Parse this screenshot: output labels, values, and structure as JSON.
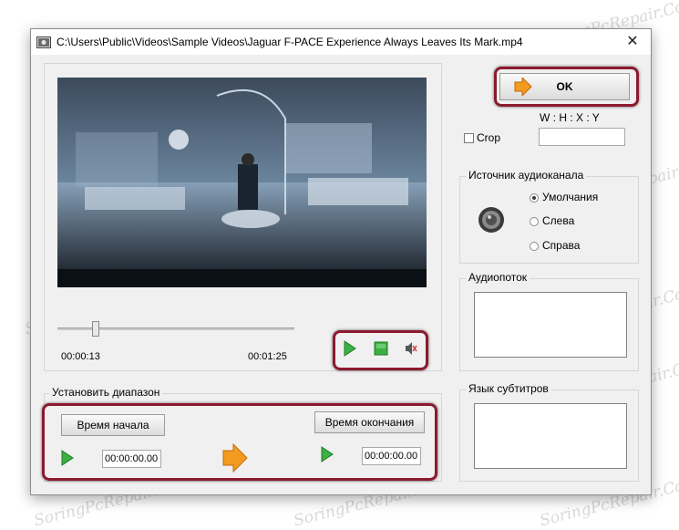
{
  "window": {
    "title": "C:\\Users\\Public\\Videos\\Sample Videos\\Jaguar F-PACE Experience Always Leaves Its Mark.mp4",
    "close_label": "✕"
  },
  "player": {
    "current_time": "00:00:13",
    "total_time": "00:01:25",
    "position_fraction": 0.16
  },
  "ok_button": {
    "label": "OK"
  },
  "crop": {
    "label": "Crop",
    "ratio_label": "W : H : X : Y",
    "value": ""
  },
  "audio_channel": {
    "title": "Источник аудиоканала",
    "options": [
      "Умолчания",
      "Слева",
      "Справа"
    ],
    "selected": "Умолчания"
  },
  "audio_stream": {
    "title": "Аудиопоток"
  },
  "subtitles": {
    "title": "Язык субтитров"
  },
  "range": {
    "title": "Установить диапазон",
    "start_label": "Время начала",
    "end_label": "Время окончания",
    "start_value": "00:00:00.00",
    "end_value": "00:00:00.00"
  },
  "watermark": "SoringPcRepair.Com",
  "colors": {
    "highlight_frame": "#8b1a2f",
    "play_green": "#3cb043",
    "arrow_orange": "#f39a21"
  }
}
